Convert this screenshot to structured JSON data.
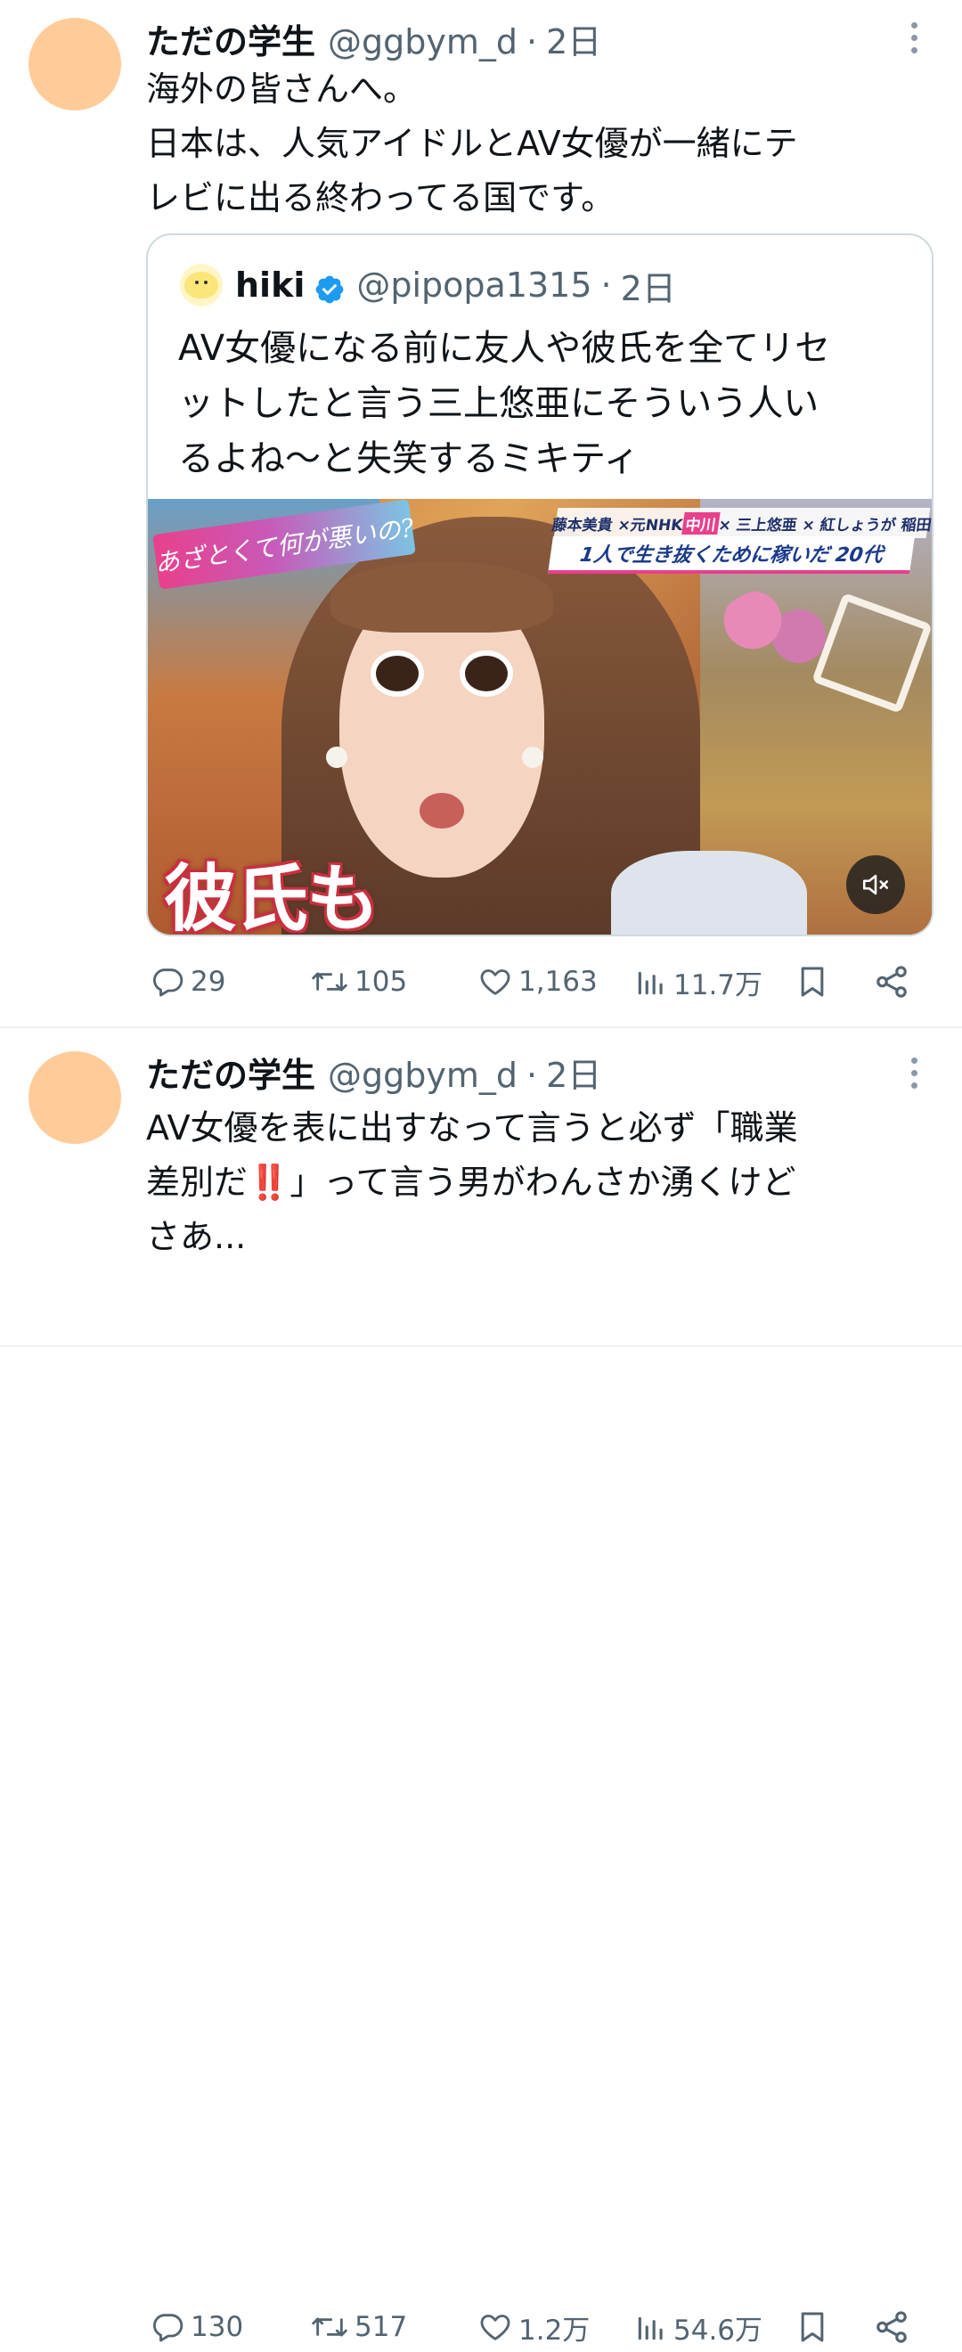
{
  "tweets": [
    {
      "display_name": "ただの学生",
      "handle": "@ggbym_d",
      "separator": "·",
      "time": "2日",
      "avatar_color": "#ffcc99",
      "text_lines": [
        "海外の皆さんへ。",
        "日本は、人気アイドルとAV女優が一緒にテ",
        "レビに出る終わってる国です。"
      ],
      "quote": {
        "display_name": "hiki",
        "verified": true,
        "handle": "@pipopa1315",
        "separator": "·",
        "time": "2日",
        "text_lines": [
          "AV女優になる前に友人や彼氏を全てリセ",
          "ットしたと言う三上悠亜にそういう人い",
          "るよね〜と失笑するミキティ"
        ],
        "media": {
          "logo_text": "あざとくて何が悪いの?",
          "guest_line_parts": [
            "藤本美貴 ×元NHK ",
            "中川",
            " × 三上悠亜 × 紅しょうが 稲田"
          ],
          "subtitle": "1人で生き抜くために稼いだ 20代",
          "caption": "彼氏も",
          "mute_icon": "volume-muted-icon"
        }
      },
      "stats": {
        "replies": "29",
        "retweets": "105",
        "likes": "1,163",
        "views": "11.7万"
      }
    },
    {
      "display_name": "ただの学生",
      "handle": "@ggbym_d",
      "separator": "·",
      "time": "2日",
      "avatar_color": "#ffcc99",
      "text_lines": [
        "AV女優を表に出すなって言うと必ず「職業",
        "差別だ",
        "」って言う男がわんさか湧くけど",
        "さあ..."
      ],
      "emoji": "‼️",
      "stats": {
        "replies": "130",
        "retweets": "517",
        "likes": "1.2万",
        "views": "54.6万"
      }
    }
  ],
  "colors": {
    "text": "#0f1419",
    "secondary": "#536471",
    "verified": "#1d9bf0",
    "border": "#cfd9de",
    "divider": "#eff3f4"
  },
  "icons": {
    "reply": "reply-icon",
    "retweet": "retweet-icon",
    "like": "heart-icon",
    "views": "views-icon",
    "bookmark": "bookmark-icon",
    "share": "share-icon",
    "more": "more-vertical-icon",
    "verified": "verified-badge-icon"
  }
}
